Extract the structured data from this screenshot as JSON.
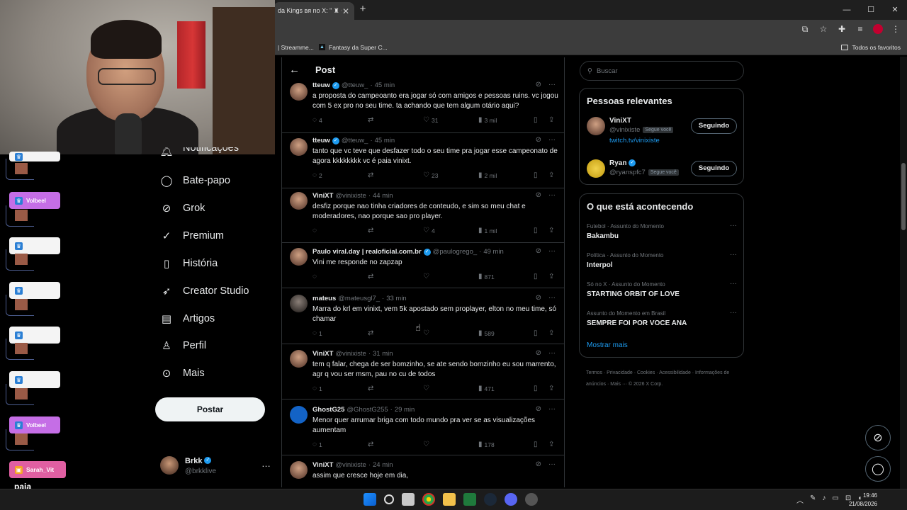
{
  "browser": {
    "tab_title": "da Kings вя no X: \" ♜ O",
    "tab_close": "✕",
    "new_tab": "+",
    "window_controls": [
      "—",
      "☐",
      "✕"
    ],
    "bookmarks": [
      "| Streamme...",
      "Fantasy da Super C..."
    ],
    "bookmarks_folder": "Todos os favoritos"
  },
  "chat_overlay": {
    "users": [
      "Volbeel",
      "Volbeel",
      "Sarah_Vit"
    ],
    "last_message": "paia"
  },
  "nav": {
    "items": [
      {
        "label": "Notificações",
        "icon": "bell-icon"
      },
      {
        "label": "Bate-papo",
        "icon": "chat-icon"
      },
      {
        "label": "Grok",
        "icon": "grok-icon"
      },
      {
        "label": "Premium",
        "icon": "premium-icon"
      },
      {
        "label": "História",
        "icon": "bookmark-icon"
      },
      {
        "label": "Creator Studio",
        "icon": "rocket-icon"
      },
      {
        "label": "Artigos",
        "icon": "article-icon"
      },
      {
        "label": "Perfil",
        "icon": "person-icon"
      },
      {
        "label": "Mais",
        "icon": "more-circle-icon"
      }
    ],
    "post_button": "Postar",
    "account": {
      "name": "Brkk",
      "handle": "@brkklive",
      "more": "…"
    }
  },
  "main": {
    "header_title": "Post",
    "tweets": [
      {
        "name": "tteuw",
        "verified": true,
        "handle": "@tteuw_",
        "time": "45 min",
        "text": "a proposta do campeoanto era jogar só com amigos e pessoas ruins. vc jogou com 5 ex pro no seu time. ta achando que tem algum otário aqui?",
        "replies": "4",
        "reposts": "",
        "likes": "31",
        "views": "3 mil"
      },
      {
        "name": "tteuw",
        "verified": true,
        "handle": "@tteuw_",
        "time": "45 min",
        "text": "tanto que vc teve que desfazer todo o seu time pra jogar esse campeonato de agora kkkkkkkk vc é paia vinixt.",
        "replies": "2",
        "reposts": "",
        "likes": "23",
        "views": "2 mil"
      },
      {
        "name": "ViniXT",
        "verified": false,
        "handle": "@vinixiste",
        "time": "44 min",
        "text": "desfiz porque nao tinha criadores de conteudo, e sim so meu chat e moderadores, nao porque sao pro player.",
        "replies": "",
        "reposts": "",
        "likes": "4",
        "views": "1 mil"
      },
      {
        "name": "Paulo viral.day | realoficial.com.br",
        "verified": true,
        "handle": "@paulogrego_",
        "time": "49 min",
        "text": "Vini me responde no zapzap",
        "replies": "",
        "reposts": "",
        "likes": "",
        "views": "871"
      },
      {
        "name": "mateus",
        "verified": false,
        "handle": "@mateusgl7_",
        "time": "33 min",
        "text": "Marra do krl em vinixt, vem 5k apostado sem proplayer, elton no meu time, só chamar",
        "replies": "1",
        "reposts": "",
        "likes": "",
        "views": "589"
      },
      {
        "name": "ViniXT",
        "verified": false,
        "handle": "@vinixiste",
        "time": "31 min",
        "text": "tem q falar, chega de ser bomzinho, se ate sendo bomzinho eu sou marrento, agr q vou ser msm, pau no cu de todos",
        "replies": "1",
        "reposts": "",
        "likes": "",
        "views": "471"
      },
      {
        "name": "GhostG25",
        "verified": false,
        "handle": "@GhostG255",
        "time": "29 min",
        "text": "Menor quer arrumar briga com todo mundo pra ver se as visualizações aumentam",
        "replies": "1",
        "reposts": "",
        "likes": "",
        "views": "178"
      },
      {
        "name": "ViniXT",
        "verified": false,
        "handle": "@vinixiste",
        "time": "24 min",
        "text": "assim que cresce hoje em dia,",
        "replies": "",
        "reposts": "",
        "likes": "",
        "views": ""
      }
    ]
  },
  "sidebar": {
    "search_placeholder": "Buscar",
    "relevant_title": "Pessoas relevantes",
    "people": [
      {
        "name": "ViniXT",
        "verified": false,
        "handle": "@vinixiste",
        "badge": "Segue você",
        "link": "twitch.tv/vinixiste",
        "button": "Seguindo"
      },
      {
        "name": "Ryan",
        "verified": true,
        "handle": "@ryanspfc7",
        "badge": "Segue você",
        "link": "",
        "button": "Seguindo"
      }
    ],
    "trends_title": "O que está acontecendo",
    "trends": [
      {
        "category": "Futebol · Assunto do Momento",
        "title": "Bakambu"
      },
      {
        "category": "Política · Assunto do Momento",
        "title": "Interpol"
      },
      {
        "category": "Só no X · Assunto do Momento",
        "title": "STARTING ORBIT OF LOVE"
      },
      {
        "category": "Assunto do Momento em Brasil",
        "title": "SEMPRE FOI POR VOCE ANA"
      }
    ],
    "show_more": "Mostrar mais",
    "footer": "Termos · Privacidade · Cookies · Acessibilidade · Informações de anúncios · Mais ···  © 2026 X Corp."
  },
  "taskbar": {
    "time": "19:46",
    "date": "21/08/2026"
  },
  "colors": {
    "accent": "#1d9bf0",
    "background": "#000000",
    "text": "#e7e9ea",
    "muted": "#71767b",
    "border": "#2f3336"
  }
}
